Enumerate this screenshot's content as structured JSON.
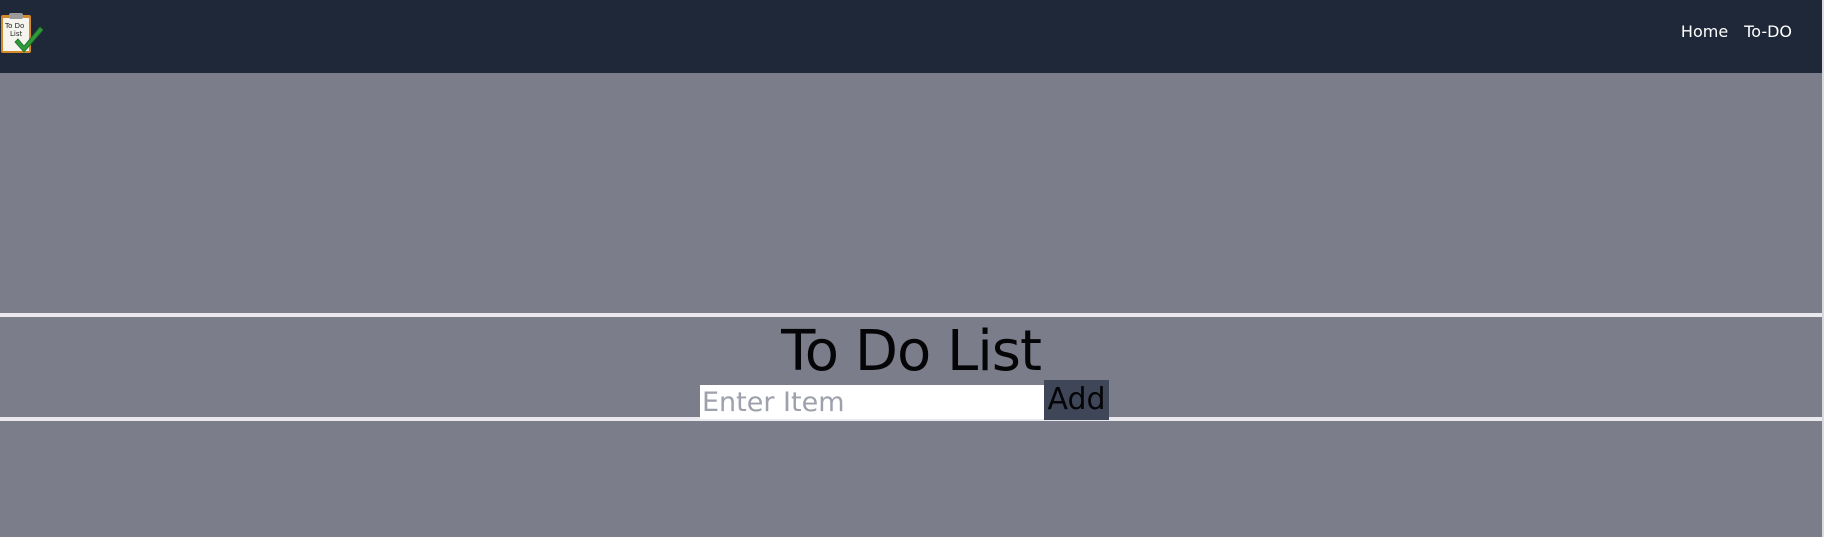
{
  "navbar": {
    "logo_icon": "todo-clipboard-checkmark-icon",
    "logo_text_line1": "To Do",
    "logo_text_line2": "List",
    "links": [
      {
        "label": "Home"
      },
      {
        "label": "To-DO"
      }
    ]
  },
  "main": {
    "title": "To Do List",
    "input": {
      "placeholder": "Enter Item",
      "value": ""
    },
    "add_label": "Add"
  },
  "colors": {
    "navbar_bg": "#1f2838",
    "page_bg": "#7b7d8a",
    "button_bg": "#3f4658",
    "divider": "#e9e9ee"
  }
}
